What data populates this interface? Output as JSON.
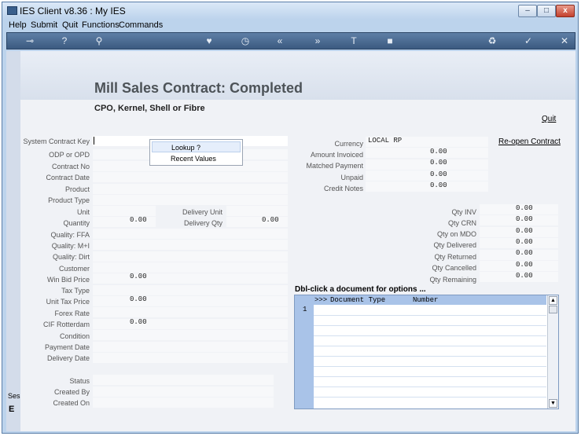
{
  "window": {
    "title": "IES Client v8.36 : My IES",
    "buttons": {
      "minimize": "–",
      "maximize": "□",
      "close": "x"
    }
  },
  "menu": [
    "Help",
    "Submit",
    "Quit",
    "Functions",
    "Commands"
  ],
  "toolbar": [
    {
      "icon": "key-icon",
      "glyph": "⊸"
    },
    {
      "icon": "help-icon",
      "glyph": "?"
    },
    {
      "icon": "search-icon",
      "glyph": "⚲"
    },
    {
      "icon": "heart-icon",
      "glyph": "♥"
    },
    {
      "icon": "clock-icon",
      "glyph": "◷"
    },
    {
      "icon": "rewind-icon",
      "glyph": "«"
    },
    {
      "icon": "forward-icon",
      "glyph": "»"
    },
    {
      "icon": "text-icon",
      "glyph": "T"
    },
    {
      "icon": "stop-icon",
      "glyph": "■"
    },
    {
      "icon": "recycle-icon",
      "glyph": "♻"
    },
    {
      "icon": "check-icon",
      "glyph": "✓"
    },
    {
      "icon": "close-icon",
      "glyph": "✕"
    }
  ],
  "page": {
    "title": "Mill Sales Contract: Completed",
    "subtitle": "CPO, Kernel, Shell or Fibre",
    "quit_link": "Quit",
    "reopen_link": "Re-open Contract"
  },
  "left_fields": {
    "system_contract_key": "System Contract Key",
    "odp_or_opd": "ODP or OPD",
    "contract_no": "Contract No",
    "contract_date": "Contract Date",
    "product": "Product",
    "product_type": "Product Type",
    "unit": "Unit",
    "quantity": "Quantity",
    "quantity_value": "0.00",
    "delivery_unit": "Delivery Unit",
    "delivery_qty": "Delivery Qty",
    "delivery_qty_value": "0.00",
    "quality_ffa": "Quality: FFA",
    "quality_mi": "Quality: M+I",
    "quality_dirt": "Quality: Dirt",
    "customer": "Customer",
    "win_bid_price": "Win Bid Price",
    "win_bid_price_value": "0.00",
    "tax_type": "Tax Type",
    "unit_tax_price": "Unit Tax Price",
    "unit_tax_price_value": "0.00",
    "forex_rate": "Forex Rate",
    "cif_rotterdam": "CIF Rotterdam",
    "cif_rotterdam_value": "0.00",
    "condition": "Condition",
    "payment_date": "Payment Date",
    "delivery_date": "Delivery Date",
    "status": "Status",
    "created_by": "Created By",
    "created_on": "Created On"
  },
  "popup": {
    "lookup": "Lookup ?",
    "recent_values": "Recent Values"
  },
  "right_fields": {
    "currency": "Currency",
    "currency_value": "LOCAL RP",
    "amount_invoiced": "Amount Invoiced",
    "amount_invoiced_value": "0.00",
    "matched_payment": "Matched Payment",
    "matched_payment_value": "0.00",
    "unpaid": "Unpaid",
    "unpaid_value": "0.00",
    "credit_notes": "Credit Notes",
    "credit_notes_value": "0.00"
  },
  "qty_fields": {
    "qty_inv": "Qty INV",
    "qty_inv_value": "0.00",
    "qty_crn": "Qty CRN",
    "qty_crn_value": "0.00",
    "qty_mdo": "Qty on MDO",
    "qty_mdo_value": "0.00",
    "qty_delivered": "Qty Delivered",
    "qty_delivered_value": "0.00",
    "qty_returned": "Qty Returned",
    "qty_returned_value": "0.00",
    "qty_cancelled": "Qty Cancelled",
    "qty_cancelled_value": "0.00",
    "qty_remaining": "Qty Remaining",
    "qty_remaining_value": "0.00"
  },
  "documents": {
    "header": "Dbl-click a document for options ...",
    "col_marker": ">>>",
    "col_type": "Document Type",
    "col_number": "Number",
    "row_number": "1"
  },
  "side": {
    "ses": "Ses",
    "e": "E"
  }
}
